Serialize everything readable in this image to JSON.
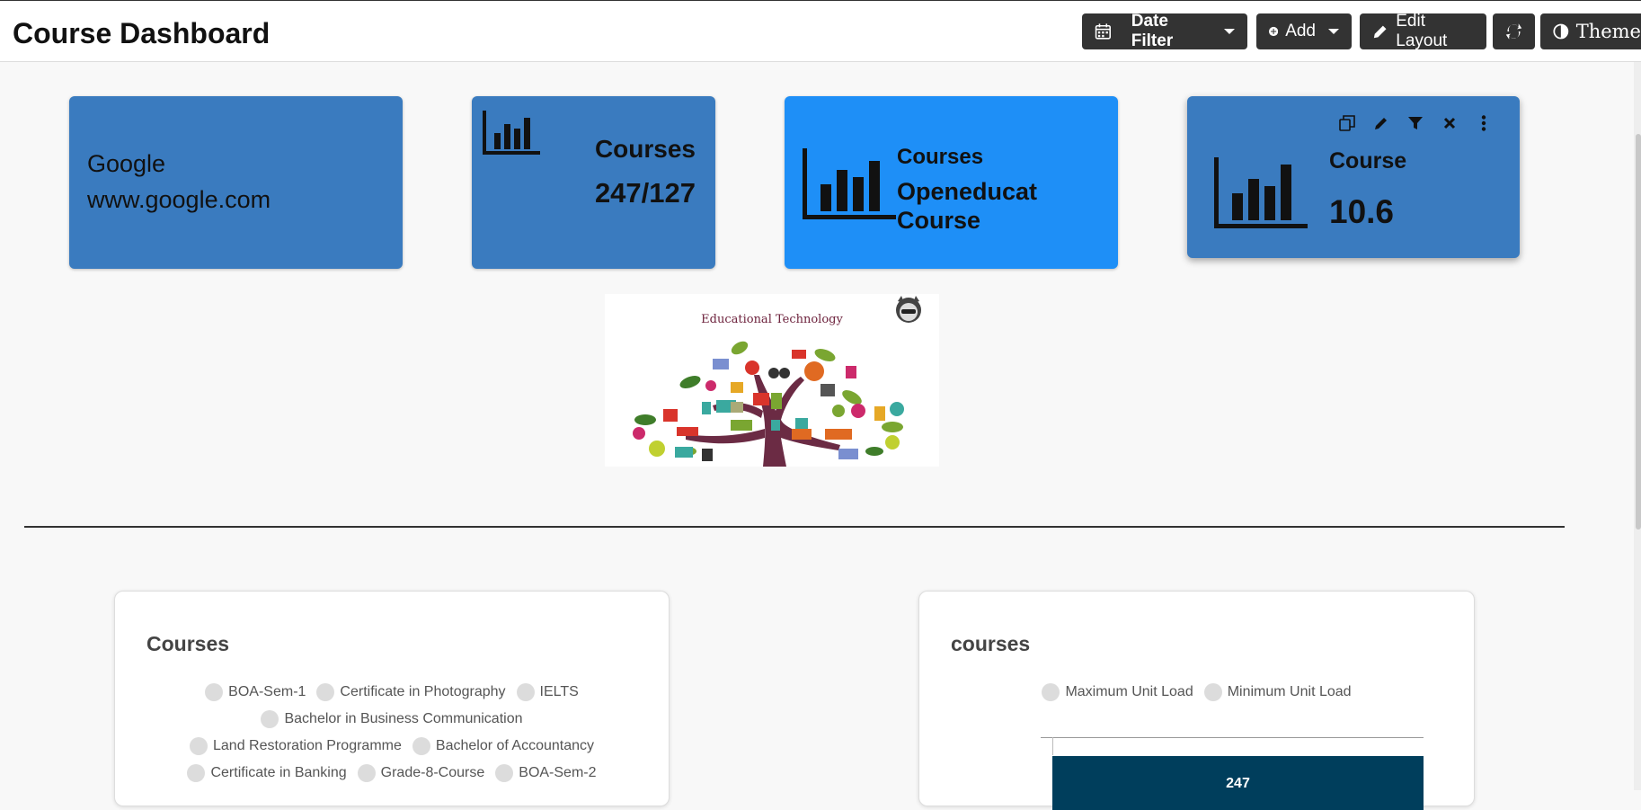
{
  "header": {
    "title": "Course Dashboard",
    "buttons": {
      "date_filter": "Date Filter",
      "add": "Add",
      "edit_layout": "Edit Layout",
      "theme": "Theme"
    }
  },
  "cards": {
    "google": {
      "line1": "Google",
      "line2": "www.google.com"
    },
    "courses_count": {
      "title": "Courses",
      "value": "247/127"
    },
    "courses_name": {
      "title": "Courses",
      "subtitle": "Openeducat Course"
    },
    "course_metric": {
      "title": "Course",
      "value": "10.6"
    }
  },
  "image_widget": {
    "title": "Educational Technology"
  },
  "panels": {
    "courses_left": {
      "title": "Courses",
      "legend_rows": [
        [
          "BOA-Sem-1",
          "Certificate in Photography",
          "IELTS"
        ],
        [
          "Bachelor in Business Communication"
        ],
        [
          "Land Restoration Programme",
          "Bachelor of Accountancy"
        ],
        [
          "Certificate in Banking",
          "Grade-8-Course",
          "BOA-Sem-2"
        ]
      ]
    },
    "courses_right": {
      "title": "courses",
      "legend": [
        "Maximum Unit Load",
        "Minimum Unit Load"
      ],
      "bar_label": "247"
    }
  },
  "colors": {
    "card_blue": "#3a7bbf",
    "card_bright_blue": "#1e8ff7",
    "bar_navy": "#003e5c",
    "header_button": "#333333"
  }
}
